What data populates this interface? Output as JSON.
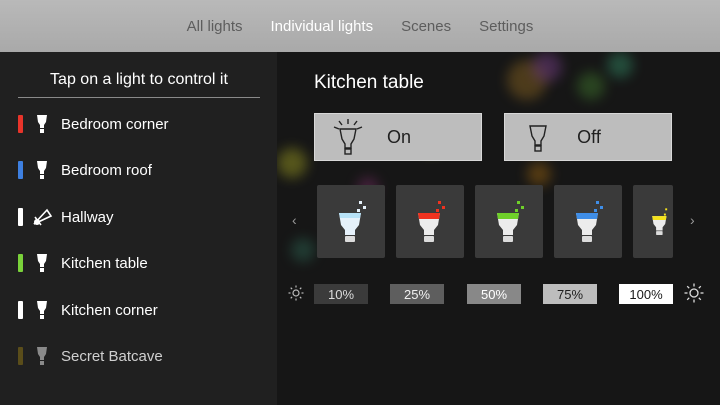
{
  "nav": {
    "tabs": [
      {
        "label": "All lights",
        "active": false
      },
      {
        "label": "Individual lights",
        "active": true
      },
      {
        "label": "Scenes",
        "active": false
      },
      {
        "label": "Settings",
        "active": false
      }
    ]
  },
  "sidebar": {
    "title": "Tap on a light to control it",
    "items": [
      {
        "label": "Bedroom corner",
        "color": "#e8342a",
        "icon": "bulb-icon"
      },
      {
        "label": "Bedroom roof",
        "color": "#3d7fe0",
        "icon": "bulb-icon"
      },
      {
        "label": "Hallway",
        "color": "#ffffff",
        "icon": "spotlight-icon"
      },
      {
        "label": "Kitchen table",
        "color": "#7ad23a",
        "icon": "bulb-icon"
      },
      {
        "label": "Kitchen corner",
        "color": "#ffffff",
        "icon": "bulb-icon"
      },
      {
        "label": "Secret Batcave",
        "color": "#5a4d1a",
        "icon": "bulb-icon"
      }
    ]
  },
  "main": {
    "title": "Kitchen table",
    "on_label": "On",
    "off_label": "Off",
    "left_arrow": "‹",
    "right_arrow": "›",
    "presets": [
      {
        "color": "#e6f2fb",
        "name": "white"
      },
      {
        "color": "#f0321f",
        "name": "red"
      },
      {
        "color": "#6fd02a",
        "name": "green"
      },
      {
        "color": "#3f8ee8",
        "name": "blue"
      },
      {
        "color": "#f4e21c",
        "name": "yellow"
      }
    ],
    "brightness": [
      {
        "label": "10%",
        "bg": "#3b3b3b",
        "fg": "#dcdcdc"
      },
      {
        "label": "25%",
        "bg": "#5e5e5e",
        "fg": "#f0f0f0"
      },
      {
        "label": "50%",
        "bg": "#888888",
        "fg": "#ffffff"
      },
      {
        "label": "75%",
        "bg": "#bdbdbd",
        "fg": "#1f1f1f"
      },
      {
        "label": "100%",
        "bg": "#ffffff",
        "fg": "#1a1a1a"
      }
    ]
  }
}
